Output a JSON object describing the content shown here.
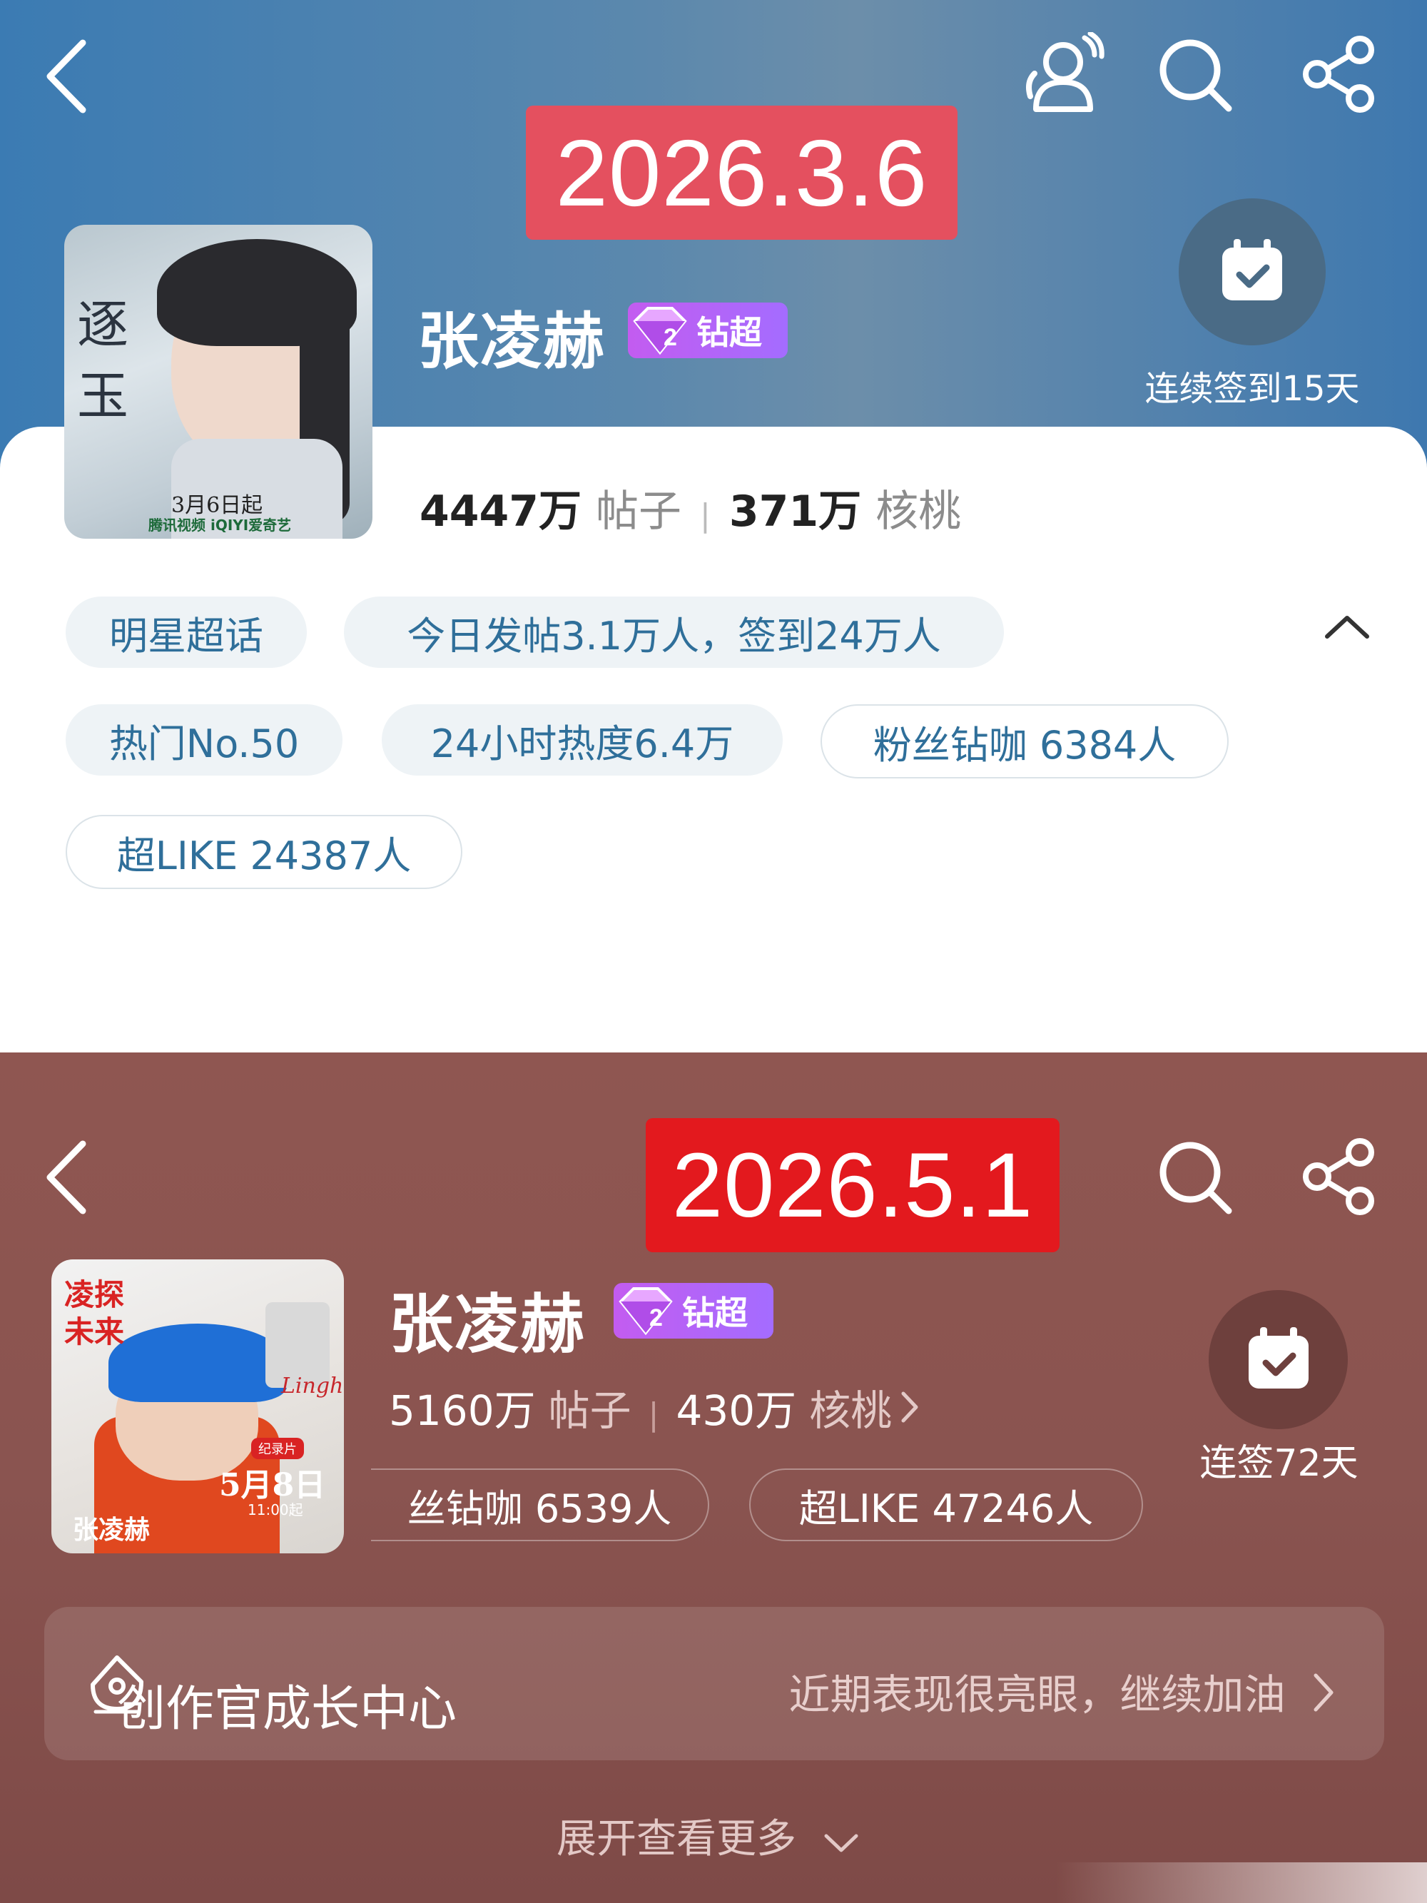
{
  "top": {
    "date": "2026.3.6",
    "name": "张凌赫",
    "badge": "钻超",
    "badge_level": "2",
    "checkin": "连续签到15天",
    "stats": {
      "posts": "4447万",
      "posts_unit": "帖子",
      "walnuts": "371万",
      "walnuts_unit": "核桃"
    },
    "chips": {
      "category": "明星超话",
      "today": "今日发帖3.1万人，签到24万人",
      "hot": "热门No.50",
      "heat": "24小时热度6.4万",
      "diamond": "粉丝钻咖 6384人",
      "like": "超LIKE 24387人"
    },
    "cover": {
      "title": "逐玉",
      "date": "3月6日起",
      "platforms": "腾讯视频 iQIYI爱奇艺"
    }
  },
  "bottom": {
    "date": "2026.5.1",
    "name": "张凌赫",
    "badge": "钻超",
    "badge_level": "2",
    "checkin": "连签72天",
    "stats": {
      "posts": "5160万",
      "posts_unit": "帖子",
      "walnuts": "430万",
      "walnuts_unit": "核桃"
    },
    "chips": {
      "diamond": "丝钻咖 6539人",
      "like": "超LIKE 47246人"
    },
    "growth": {
      "title": "创作官成长中心",
      "subtitle": "近期表现很亮眼，继续加油"
    },
    "expand": "展开查看更多",
    "cover": {
      "title": "凌探未来",
      "tag": "纪录片",
      "date": "5月8日",
      "time": "11:00起",
      "name": "张凌赫",
      "script": "Linghe"
    }
  },
  "icons": {
    "back": "chevron-left-icon",
    "weather": "people-icon",
    "search": "search-icon",
    "share": "share-icon",
    "calendar": "calendar-check-icon"
  }
}
